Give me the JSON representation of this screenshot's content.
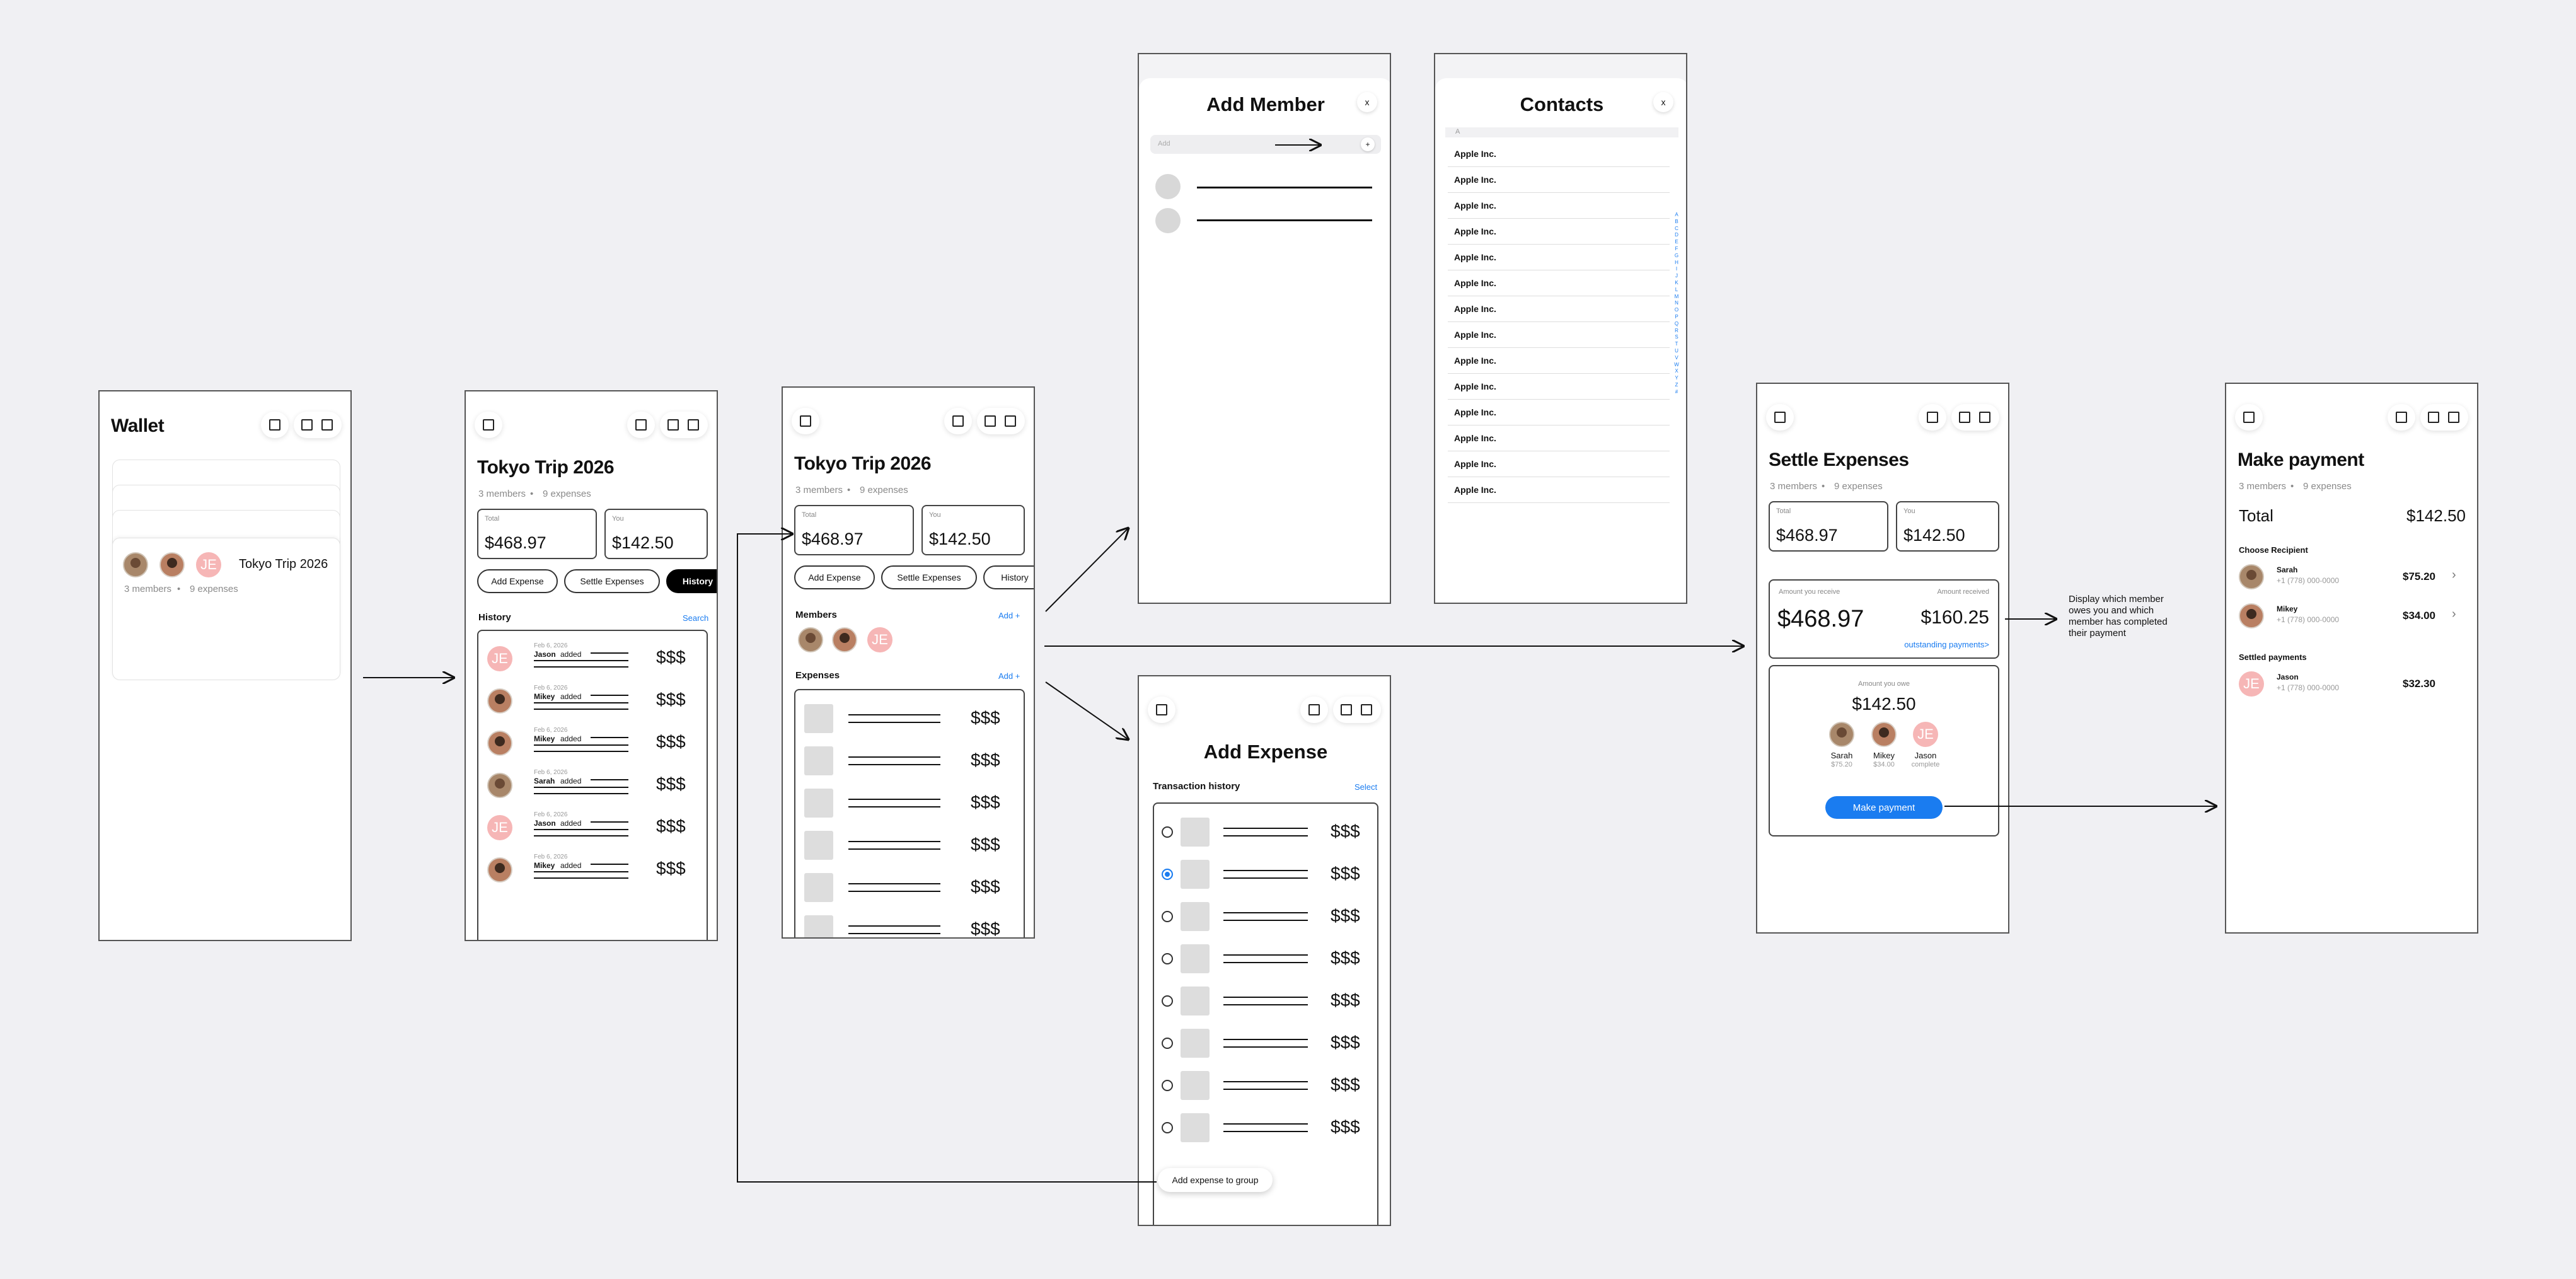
{
  "wallet": {
    "title": "Wallet",
    "group_name": "Tokyo Trip 2026",
    "members": "3 members",
    "expenses": "9 expenses",
    "avatar_initials": "JE"
  },
  "trip": {
    "title": "Tokyo Trip 2026",
    "members": "3 members",
    "expenses": "9 expenses",
    "total_label": "Total",
    "total_value": "$468.97",
    "you_label": "You",
    "you_value": "$142.50",
    "btn_add_expense": "Add Expense",
    "btn_settle": "Settle Expenses",
    "btn_history": "History"
  },
  "history": {
    "section": "History",
    "search": "Search",
    "rows": [
      {
        "date": "Feb 6, 2026",
        "name": "Jason",
        "action": "added",
        "amount": "$$$",
        "avatar": "JE"
      },
      {
        "date": "Feb 6, 2026",
        "name": "Mikey",
        "action": "added",
        "amount": "$$$",
        "avatar": ""
      },
      {
        "date": "Feb 6, 2026",
        "name": "Mikey",
        "action": "added",
        "amount": "$$$",
        "avatar": ""
      },
      {
        "date": "Feb 6, 2026",
        "name": "Sarah",
        "action": "added",
        "amount": "$$$",
        "avatar": ""
      },
      {
        "date": "Feb 6, 2026",
        "name": "Jason",
        "action": "added",
        "amount": "$$$",
        "avatar": "JE"
      },
      {
        "date": "Feb 6, 2026",
        "name": "Mikey",
        "action": "added",
        "amount": "$$$",
        "avatar": ""
      }
    ]
  },
  "group": {
    "members_section": "Members",
    "add": "Add +",
    "expenses_section": "Expenses",
    "amounts": [
      "$$$",
      "$$$",
      "$$$",
      "$$$",
      "$$$",
      "$$$"
    ]
  },
  "add_member": {
    "title": "Add Member",
    "close": "x",
    "search_placeholder": "Add",
    "plus": "+"
  },
  "contacts": {
    "title": "Contacts",
    "close": "x",
    "section_letter": "A",
    "items": [
      "Apple Inc.",
      "Apple Inc.",
      "Apple Inc.",
      "Apple Inc.",
      "Apple Inc.",
      "Apple Inc.",
      "Apple Inc.",
      "Apple Inc.",
      "Apple Inc.",
      "Apple Inc.",
      "Apple Inc.",
      "Apple Inc.",
      "Apple Inc.",
      "Apple Inc."
    ],
    "alphabet": [
      "A",
      "B",
      "C",
      "D",
      "E",
      "F",
      "G",
      "H",
      "I",
      "J",
      "K",
      "L",
      "M",
      "N",
      "O",
      "P",
      "Q",
      "R",
      "S",
      "T",
      "U",
      "V",
      "W",
      "X",
      "Y",
      "Z",
      "#"
    ]
  },
  "add_expense": {
    "title": "Add Expense",
    "section": "Transaction history",
    "select": "Select",
    "amounts": [
      "$$$",
      "$$$",
      "$$$",
      "$$$",
      "$$$",
      "$$$",
      "$$$",
      "$$$"
    ],
    "selected_index": 1,
    "cta": "Add expense to group"
  },
  "settle": {
    "title": "Settle Expenses",
    "members": "3 members",
    "expenses": "9 expenses",
    "total_label": "Total",
    "total_value": "$468.97",
    "you_label": "You",
    "you_value": "$142.50",
    "receive_label": "Amount you receive",
    "receive_value": "$468.97",
    "received_label": "Amount received",
    "received_value": "$160.25",
    "outstanding": "outstanding payments>",
    "owe_label": "Amount you owe",
    "owe_value": "$142.50",
    "people": [
      {
        "name": "Sarah",
        "sub": "$75.20"
      },
      {
        "name": "Mikey",
        "sub": "$34.00"
      },
      {
        "name": "Jason",
        "sub": "complete"
      }
    ],
    "cta": "Make payment"
  },
  "annotation": "Display which member owes you and which member has completed their payment",
  "payment": {
    "title": "Make payment",
    "members": "3 members",
    "expenses": "9 expenses",
    "total_label": "Total",
    "total_value": "$142.50",
    "choose": "Choose Recipient",
    "recipients": [
      {
        "name": "Sarah",
        "phone": "+1 (778) 000-0000",
        "amount": "$75.20"
      },
      {
        "name": "Mikey",
        "phone": "+1 (778) 000-0000",
        "amount": "$34.00"
      }
    ],
    "settled": "Settled payments",
    "settled_items": [
      {
        "name": "Jason",
        "phone": "+1 (778) 000-0000",
        "amount": "$32.30"
      }
    ]
  },
  "colors": {
    "background": "#f0f0f3",
    "accent": "#1a7cf0",
    "avatar_pink": "#f6b6b6"
  }
}
